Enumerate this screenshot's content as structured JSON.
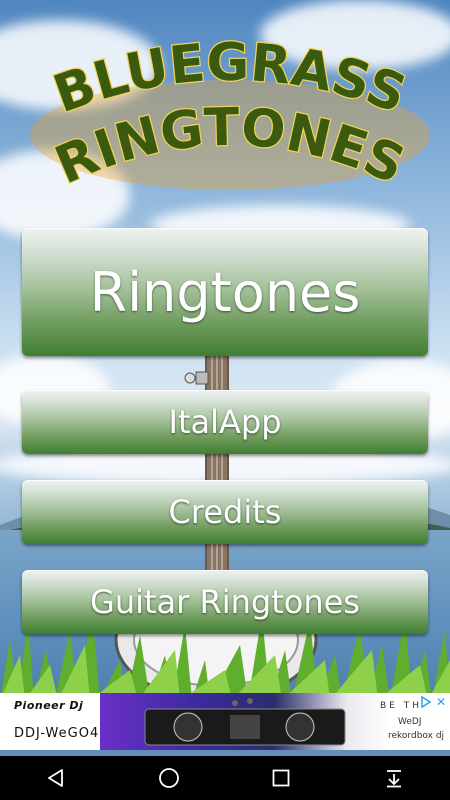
{
  "logo": {
    "line1": "BLUEGRASS",
    "line2": "RINGTONES"
  },
  "buttons": {
    "ringtones": "Ringtones",
    "italapp": "ItalApp",
    "credits": "Credits",
    "guitar_ringtones": "Guitar Ringtones"
  },
  "ad": {
    "brand": "Pioneer Dj",
    "model": "DDJ-WeGO4",
    "tagline": "BE TH",
    "wedj": "WeDJ",
    "rekordbox": "rekordbox dj"
  },
  "navbar": {
    "icons": [
      "back-icon",
      "home-icon",
      "recents-icon",
      "notification-pull-icon"
    ]
  },
  "colors": {
    "button_top": "#eef3ef",
    "button_bottom": "#3f7f32",
    "logo_text": "#3a5a10",
    "logo_outline": "#f3d25a"
  }
}
